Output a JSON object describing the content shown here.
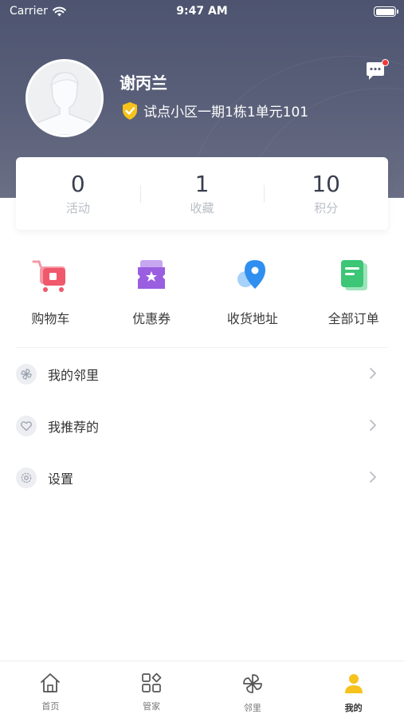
{
  "status_bar": {
    "carrier": "Carrier",
    "time": "9:47 AM"
  },
  "profile": {
    "name": "谢丙兰",
    "address": "试点小区一期1栋1单元101"
  },
  "stats": [
    {
      "value": "0",
      "label": "活动"
    },
    {
      "value": "1",
      "label": "收藏"
    },
    {
      "value": "10",
      "label": "积分"
    }
  ],
  "quick_actions": [
    {
      "label": "购物车",
      "icon": "shopping-cart-icon",
      "color": "#f0586c"
    },
    {
      "label": "优惠券",
      "icon": "coupon-icon",
      "color": "#9a5ee0"
    },
    {
      "label": "收货地址",
      "icon": "location-pin-icon",
      "color": "#2f8ff0"
    },
    {
      "label": "全部订单",
      "icon": "order-list-icon",
      "color": "#3cc676"
    }
  ],
  "menu": [
    {
      "label": "我的邻里",
      "icon": "pinwheel-icon"
    },
    {
      "label": "我推荐的",
      "icon": "heart-icon"
    },
    {
      "label": "设置",
      "icon": "gear-icon"
    }
  ],
  "tabs": [
    {
      "label": "首页",
      "icon": "home-icon"
    },
    {
      "label": "管家",
      "icon": "grid-icon"
    },
    {
      "label": "邻里",
      "icon": "pinwheel-icon"
    },
    {
      "label": "我的",
      "icon": "person-icon",
      "active": true
    }
  ],
  "colors": {
    "header": "#535a73",
    "accent": "#f7c21b",
    "badge": "#f03a3a"
  }
}
